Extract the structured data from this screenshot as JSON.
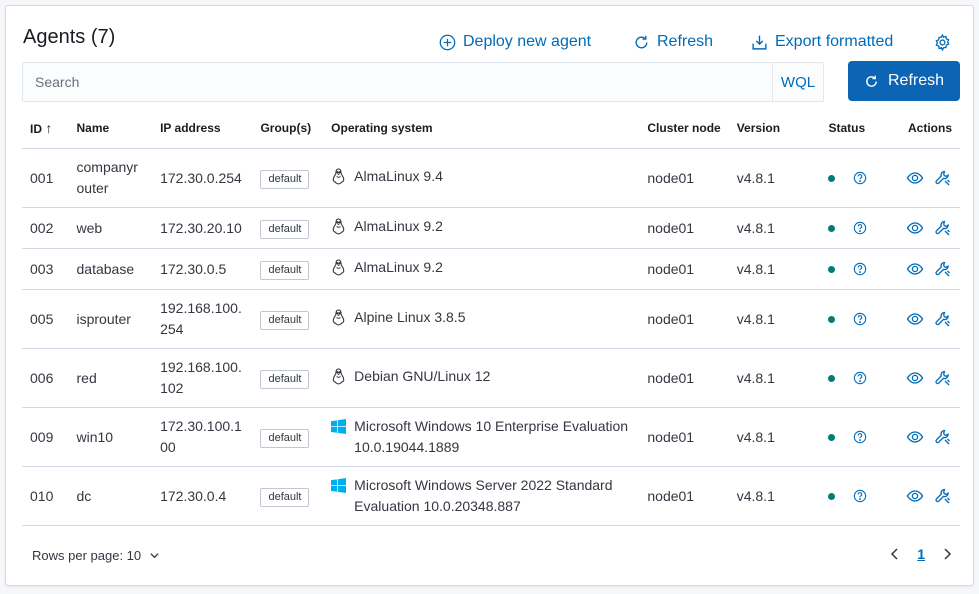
{
  "header": {
    "title": "Agents (7)",
    "deploy_label": "Deploy new agent",
    "refresh_label": "Refresh",
    "export_label": "Export formatted"
  },
  "search": {
    "placeholder": "Search",
    "value": "",
    "wql_label": "WQL",
    "refresh_button": "Refresh"
  },
  "table": {
    "columns": [
      "ID",
      "Name",
      "IP address",
      "Group(s)",
      "Operating system",
      "Cluster node",
      "Version",
      "Status",
      "Actions"
    ],
    "sort_column": "ID",
    "sort_direction": "ascending",
    "rows": [
      {
        "id": "001",
        "name": "companyrouter",
        "ip": "172.30.0.254",
        "group": "default",
        "os": "AlmaLinux 9.4",
        "os_icon": "linux-tux-icon",
        "node": "node01",
        "version": "v4.8.1",
        "status": "active"
      },
      {
        "id": "002",
        "name": "web",
        "ip": "172.30.20.10",
        "group": "default",
        "os": "AlmaLinux 9.2",
        "os_icon": "linux-tux-icon",
        "node": "node01",
        "version": "v4.8.1",
        "status": "active"
      },
      {
        "id": "003",
        "name": "database",
        "ip": "172.30.0.5",
        "group": "default",
        "os": "AlmaLinux 9.2",
        "os_icon": "linux-tux-icon",
        "node": "node01",
        "version": "v4.8.1",
        "status": "active"
      },
      {
        "id": "005",
        "name": "isprouter",
        "ip": "192.168.100.254",
        "group": "default",
        "os": "Alpine Linux 3.8.5",
        "os_icon": "linux-tux-icon",
        "node": "node01",
        "version": "v4.8.1",
        "status": "active"
      },
      {
        "id": "006",
        "name": "red",
        "ip": "192.168.100.102",
        "group": "default",
        "os": "Debian GNU/Linux 12",
        "os_icon": "linux-tux-icon",
        "node": "node01",
        "version": "v4.8.1",
        "status": "active"
      },
      {
        "id": "009",
        "name": "win10",
        "ip": "172.30.100.100",
        "group": "default",
        "os": "Microsoft Windows 10 Enterprise Evaluation 10.0.19044.1889",
        "os_icon": "windows-icon",
        "node": "node01",
        "version": "v4.8.1",
        "status": "active"
      },
      {
        "id": "010",
        "name": "dc",
        "ip": "172.30.0.4",
        "group": "default",
        "os": "Microsoft Windows Server 2022 Standard Evaluation 10.0.20348.887",
        "os_icon": "windows-icon",
        "node": "node01",
        "version": "v4.8.1",
        "status": "active"
      }
    ]
  },
  "footer": {
    "rows_per_page_label": "Rows per page: 10",
    "current_page": "1"
  },
  "colors": {
    "accent": "#006bb8",
    "primary_button": "#0b64b4",
    "status_active": "#017d73"
  }
}
